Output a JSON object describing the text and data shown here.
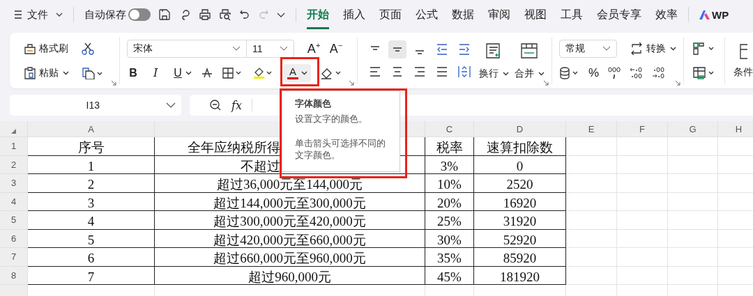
{
  "top_bar": {
    "menu_label": "文件",
    "autosave_label": "自动保存",
    "autosave_on": false,
    "redo_disabled": true,
    "tabs": [
      {
        "label": "开始",
        "selected": true
      },
      {
        "label": "插入",
        "selected": false
      },
      {
        "label": "页面",
        "selected": false
      },
      {
        "label": "公式",
        "selected": false
      },
      {
        "label": "数据",
        "selected": false
      },
      {
        "label": "审阅",
        "selected": false
      },
      {
        "label": "视图",
        "selected": false
      },
      {
        "label": "工具",
        "selected": false
      },
      {
        "label": "会员专享",
        "selected": false
      },
      {
        "label": "效率",
        "selected": false
      }
    ],
    "brand": "WP"
  },
  "ribbon": {
    "format_painter": "格式刷",
    "paste": "粘贴",
    "font_name": "宋体",
    "font_size": "11",
    "grow_font": "A$^{+}$",
    "shrink_font": "A$^{−}$",
    "format_buttons": [
      {
        "kind": "bold",
        "label": "B"
      },
      {
        "kind": "italic",
        "label": "I"
      },
      {
        "kind": "underline",
        "label": "U"
      }
    ],
    "font_color_label": "A",
    "vertical_align": [
      {
        "kind": "top",
        "selected": false
      },
      {
        "kind": "middle",
        "selected": true
      },
      {
        "kind": "bottom",
        "selected": false
      }
    ],
    "wrap": "换行",
    "merge": "合并",
    "number_format": "常规",
    "convert": "转换",
    "percent": "%",
    "conditional": "条件"
  },
  "name_box": "I13",
  "formula_label": "fx",
  "tooltip": {
    "title": "字体颜色",
    "description": "设置文字的颜色。",
    "hint": "单击箭头可选择不同的文字颜色。"
  },
  "sheet": {
    "column_headers": [
      "A",
      "C",
      "D",
      "E",
      "F",
      "G",
      "H"
    ],
    "row_headers": [
      "1",
      "2",
      "3",
      "4",
      "5",
      "6",
      "7",
      "8"
    ],
    "rows": [
      [
        "序号",
        "全年应纳税所得",
        "税率",
        "速算扣除数"
      ],
      [
        "1",
        "不超过",
        "3%",
        "0"
      ],
      [
        "2",
        "超过36,000元至144,000元",
        "10%",
        "2520"
      ],
      [
        "3",
        "超过144,000元至300,000元",
        "20%",
        "16920"
      ],
      [
        "4",
        "超过300,000元至420,000元",
        "25%",
        "31920"
      ],
      [
        "5",
        "超过420,000元至660,000元",
        "30%",
        "52920"
      ],
      [
        "6",
        "超过660,000元至960,000元",
        "35%",
        "85920"
      ],
      [
        "7",
        "超过960,000元",
        "45%",
        "181920"
      ]
    ]
  }
}
